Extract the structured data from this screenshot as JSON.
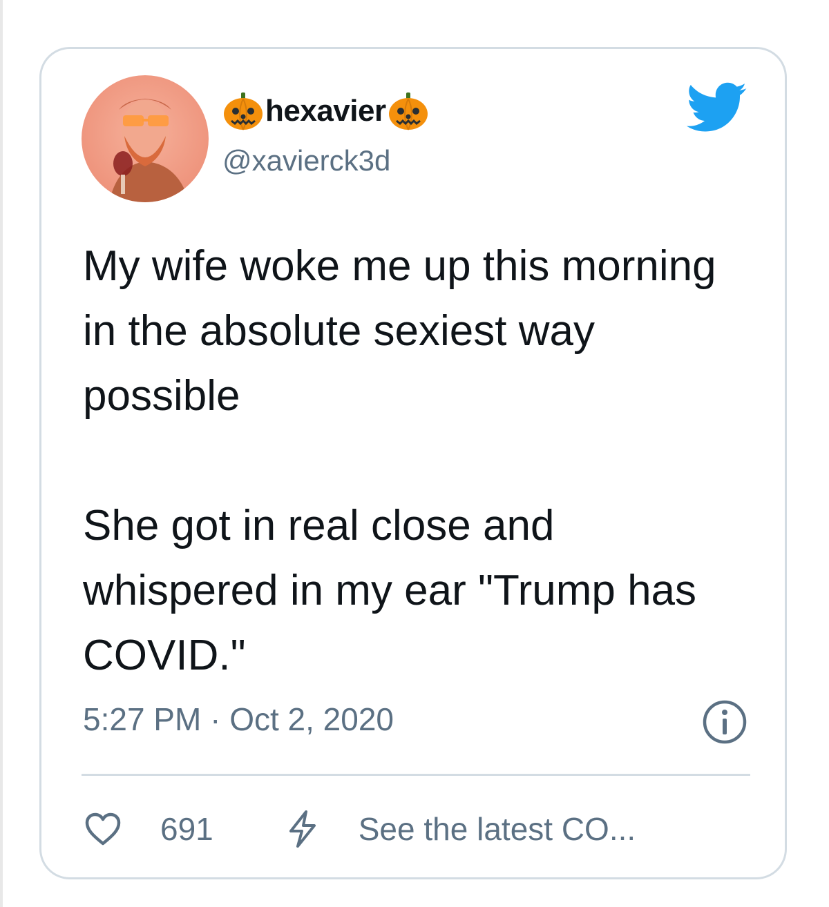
{
  "tweet": {
    "display_name": "hexavier",
    "name_emoji_icon": "jack-o-lantern-icon",
    "handle": "@xavierck3d",
    "logo_icon": "twitter-bird-icon",
    "text_paragraphs": [
      "My wife woke me up this morning in the absolute sexiest way possible",
      "She got in real close and whispered in my ear \"Trump has COVID.\""
    ],
    "timestamp": "5:27 PM · Oct 2, 2020",
    "info_icon": "info-icon",
    "like_icon": "heart-icon",
    "like_count": "691",
    "news_icon": "lightning-bolt-icon",
    "news_label": "See the latest CO..."
  },
  "colors": {
    "text": "#0f1419",
    "secondary": "#5b7083",
    "twitter_blue": "#1da1f2",
    "border": "#d3dce3",
    "pumpkin": "#f4900c"
  }
}
